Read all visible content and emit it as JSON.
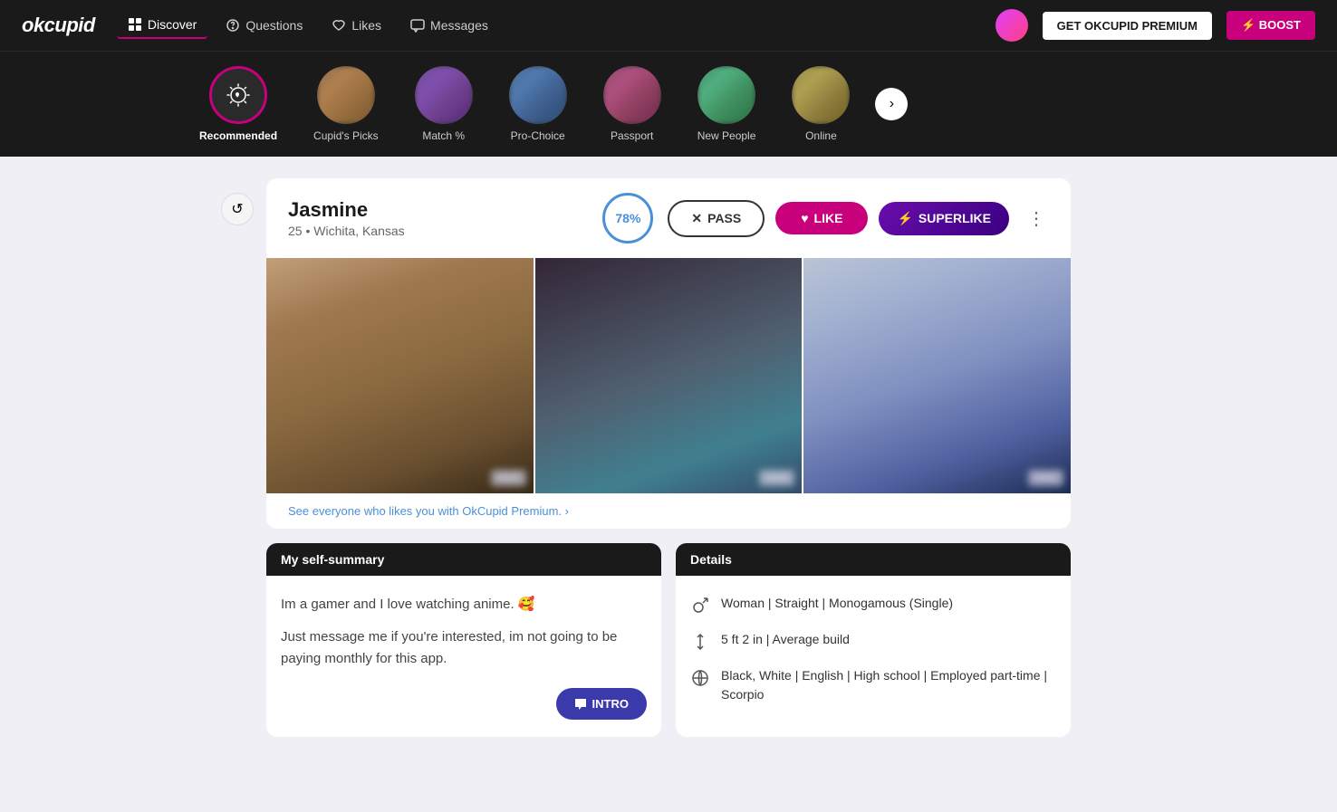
{
  "brand": {
    "logo": "okcupid",
    "logoStyle": "italic"
  },
  "topNav": {
    "items": [
      {
        "id": "discover",
        "label": "Discover",
        "icon": "grid",
        "active": true
      },
      {
        "id": "questions",
        "label": "Questions",
        "icon": "help-circle"
      },
      {
        "id": "likes",
        "label": "Likes",
        "icon": "heart"
      },
      {
        "id": "messages",
        "label": "Messages",
        "icon": "chat"
      }
    ],
    "premiumBtn": "GET OKCUPID PREMIUM",
    "boostBtn": "⚡ BOOST"
  },
  "categories": [
    {
      "id": "recommended",
      "label": "Recommended",
      "active": true,
      "type": "icon"
    },
    {
      "id": "cupids-picks",
      "label": "Cupid's Picks",
      "active": false,
      "type": "photo"
    },
    {
      "id": "match",
      "label": "Match %",
      "active": false,
      "type": "photo"
    },
    {
      "id": "pro-choice",
      "label": "Pro-Choice",
      "active": false,
      "type": "photo"
    },
    {
      "id": "passport",
      "label": "Passport",
      "active": false,
      "type": "photo"
    },
    {
      "id": "new-people",
      "label": "New People",
      "active": false,
      "type": "photo"
    },
    {
      "id": "online",
      "label": "Online",
      "active": false,
      "type": "photo"
    }
  ],
  "profile": {
    "name": "Jasmine",
    "age": "25",
    "location": "Wichita, Kansas",
    "matchPercent": "78%",
    "actions": {
      "pass": "PASS",
      "like": "LIKE",
      "superlike": "SUPERLIKE"
    },
    "premiumLink": "See everyone who likes you with OkCupid Premium. ›",
    "selfSummary": {
      "header": "My self-summary",
      "text1": "Im a gamer and I love watching anime. 🥰",
      "text2": "Just message me if you're interested, im not going to be paying monthly for this app.",
      "introBtn": "INTRO"
    },
    "details": {
      "header": "Details",
      "row1": "Woman | Straight | Monogamous (Single)",
      "row2": "5 ft 2 in | Average build",
      "row3": "Black, White | English | High school | Employed part-time | Scorpio"
    }
  }
}
